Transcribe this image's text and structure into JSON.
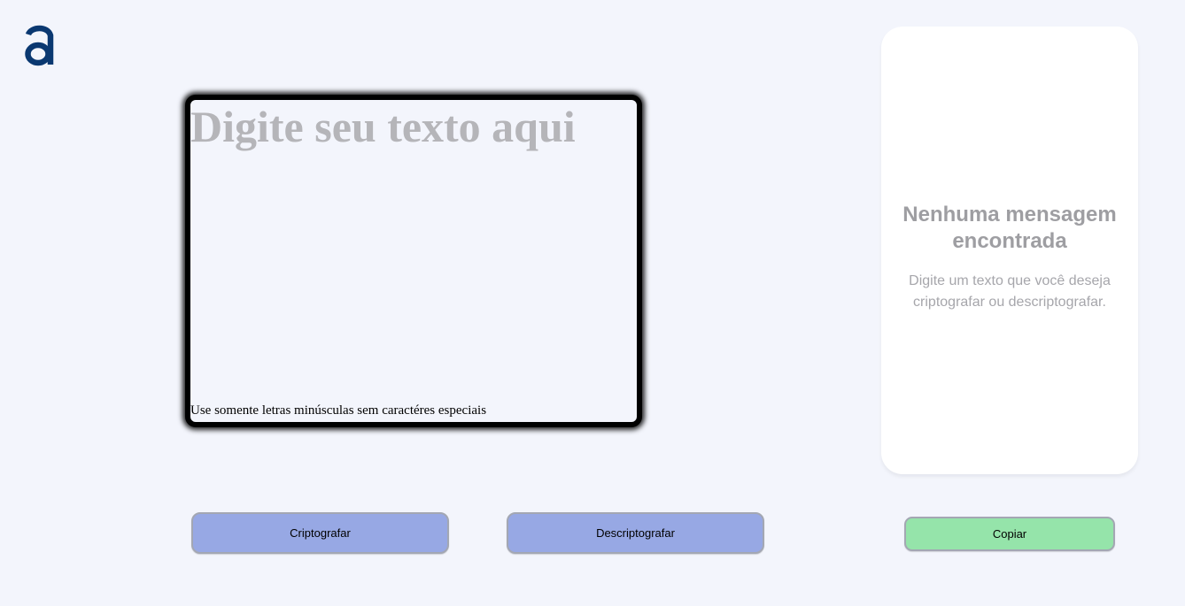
{
  "logo": {
    "icon": "letter-a-logo-icon",
    "color": "#0a3871"
  },
  "editor": {
    "placeholder": "Digite seu texto aqui",
    "value": "",
    "hint": "Use somente letras minúsculas sem caractéres especiais",
    "border_color": "#000000"
  },
  "output_panel": {
    "title": "Nenhuma mensagem encontrada",
    "message": "Digite um texto que você deseja criptografar ou descriptografar."
  },
  "buttons": {
    "encrypt_label": "Criptografar",
    "decrypt_label": "Descriptografar",
    "copy_label": "Copiar"
  },
  "colors": {
    "background": "#f3f5fc",
    "primary_button": "#97a8e4",
    "copy_button": "#95e4aa"
  }
}
